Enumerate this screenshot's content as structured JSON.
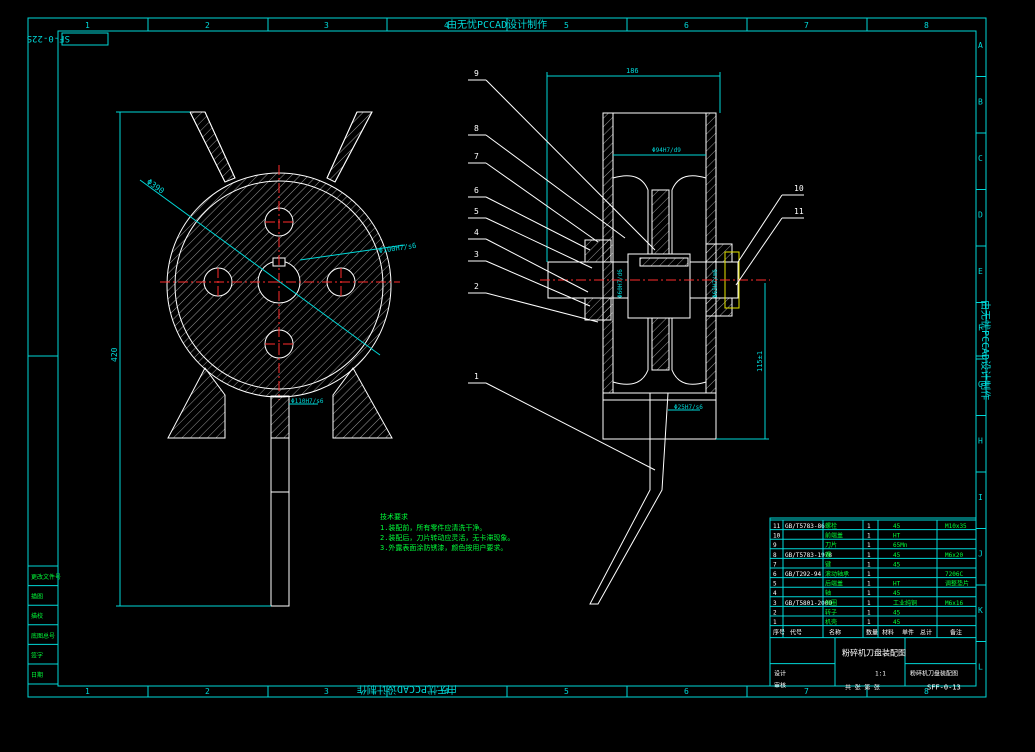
{
  "colors": {
    "frame": "#00d8d8",
    "line": "#ffffff",
    "accent": "#ff2b2b",
    "note": "#00ff3a",
    "bg": "#000000",
    "label": "#e8e800"
  },
  "frame": {
    "col_numbers": [
      "1",
      "2",
      "3",
      "4",
      "5",
      "6",
      "7",
      "8"
    ],
    "row_letters": [
      "A",
      "B",
      "C",
      "D",
      "E",
      "F",
      "G",
      "H",
      "I",
      "J",
      "K",
      "L"
    ],
    "top_banner": "由无忧PCCAD设计制作",
    "bottom_banner": "由无忧PCCAD设计制作",
    "side_banner": "由无忧PCCAD设计制作",
    "drawing_no_box": "SF-0-22S"
  },
  "left_view": {
    "dim_height": "420",
    "dim_radius": "Φ390",
    "dim_bore": "Φ100H7/s6",
    "dim_bottom": "Φ110H7/s6"
  },
  "right_view": {
    "dim_top": "186",
    "dim_inner": "Φ94H7/d9",
    "dim_left_bore": "Φ60H7/d6",
    "dim_right_bore": "Φ65H7/m6",
    "dim_bottom": "Φ25H7/s6",
    "dim_side": "115±1",
    "balloons": [
      "9",
      "8",
      "7",
      "6",
      "5",
      "4",
      "3",
      "2",
      "1",
      "10",
      "11"
    ]
  },
  "notes": {
    "title": "技术要求",
    "lines": [
      "1.装配前，所有零件应清洗干净。",
      "2.装配后，刀片转动应灵活，无卡滞现象。",
      "3.外露表面涂防锈漆，颜色按用户要求。"
    ]
  },
  "left_revision_block": [
    "更改文件号",
    "描图",
    "描校",
    "底图总号",
    "签字",
    "日期"
  ],
  "parts_list": {
    "rows": [
      {
        "no": "11",
        "code": "GB/T5783-86",
        "name": "螺栓",
        "qty": "1",
        "mat": "45",
        "note": "M10x35"
      },
      {
        "no": "10",
        "code": "",
        "name": "前端盖",
        "qty": "1",
        "mat": "HT",
        "note": ""
      },
      {
        "no": "9",
        "code": "",
        "name": "刀片",
        "qty": "1",
        "mat": "65Mn",
        "note": ""
      },
      {
        "no": "8",
        "code": "GB/T5783-1978",
        "name": "螺",
        "qty": "1",
        "mat": "45",
        "note": "M6x20"
      },
      {
        "no": "7",
        "code": "",
        "name": "键",
        "qty": "1",
        "mat": "45",
        "note": ""
      },
      {
        "no": "6",
        "code": "GB/T292-94",
        "name": "滚动轴承",
        "qty": "1",
        "mat": "",
        "note": "7206C"
      },
      {
        "no": "5",
        "code": "",
        "name": "后端盖",
        "qty": "1",
        "mat": "HT",
        "note": "调整垫片"
      },
      {
        "no": "4",
        "code": "",
        "name": "轴",
        "qty": "1",
        "mat": "45",
        "note": ""
      },
      {
        "no": "3",
        "code": "GB/T5801-2000",
        "name": "挡圈",
        "qty": "1",
        "mat": "工业纯铜",
        "note": "M6x16"
      },
      {
        "no": "2",
        "code": "",
        "name": "转子",
        "qty": "1",
        "mat": "45",
        "note": ""
      },
      {
        "no": "1",
        "code": "",
        "name": "机壳",
        "qty": "1",
        "mat": "45",
        "note": ""
      }
    ],
    "header": [
      "序号",
      "代号",
      "名称",
      "数量",
      "材料",
      "单件",
      "总计",
      "备注"
    ],
    "title": "粉碎机刀盘装配图",
    "subtitle": "粉碎机刀盘装配图",
    "drawing_no": "SFF-0-13",
    "scale": "1:1",
    "sheet_label": "共 张 第 张",
    "designer": "设计",
    "checker": "审核"
  }
}
